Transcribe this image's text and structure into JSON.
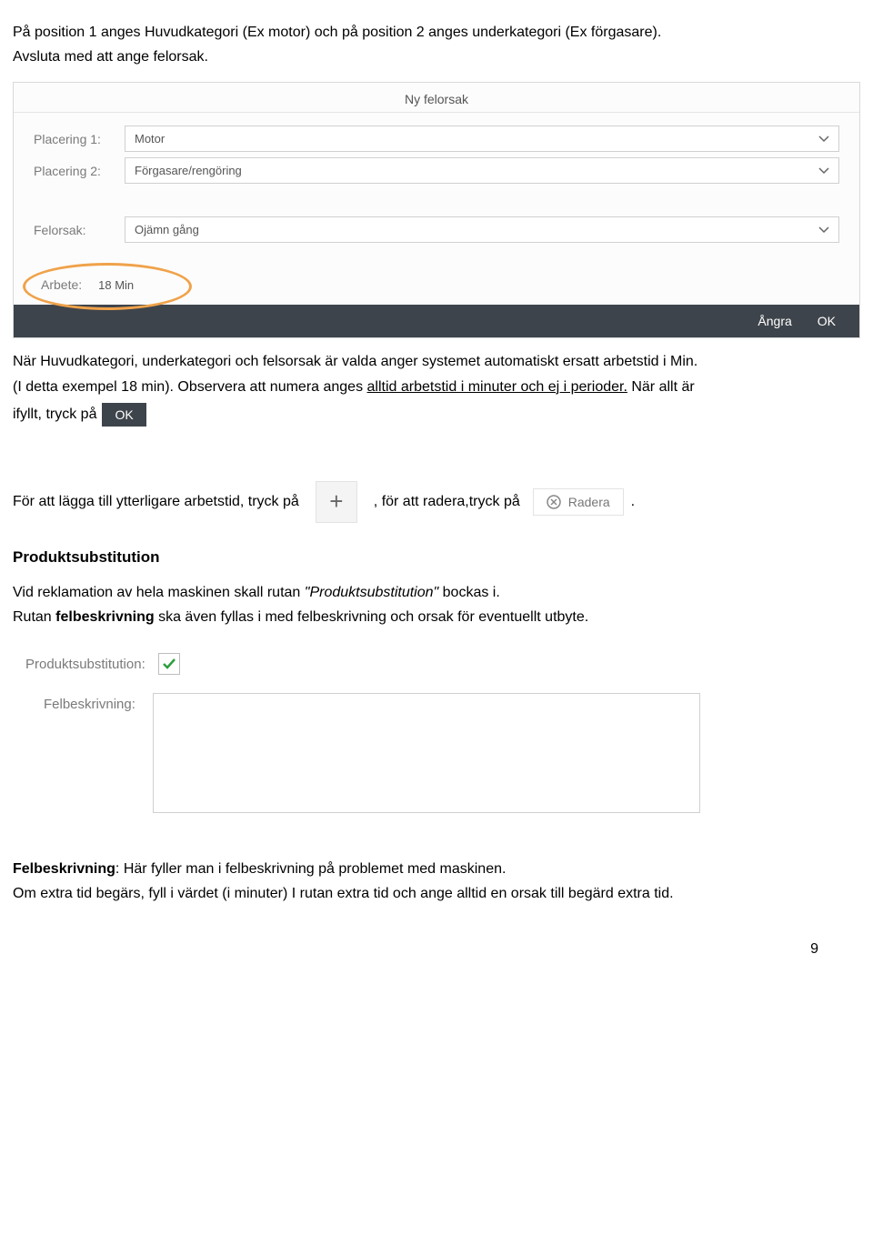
{
  "intro": {
    "line1": "På position 1 anges Huvudkategori (Ex motor) och på position 2 anges underkategori (Ex förgasare).",
    "line2": "Avsluta med att ange felorsak."
  },
  "dialog": {
    "title": "Ny felorsak",
    "labels": {
      "placering1": "Placering 1:",
      "placering2": "Placering 2:",
      "felorsak": "Felorsak:",
      "arbete": "Arbete:"
    },
    "values": {
      "placering1": "Motor",
      "placering2": "Förgasare/rengöring",
      "felorsak": "Ojämn gång",
      "arbete": "18 Min"
    },
    "footer": {
      "angra": "Ångra",
      "ok": "OK"
    }
  },
  "after_dialog": {
    "sentence_a": "När Huvudkategori, underkategori och felsorsak är valda anger systemet automatiskt ersatt arbetstid i Min.",
    "sentence_b_prefix": "(I detta exempel 18 min). Observera att numera anges ",
    "sentence_b_underline": "alltid arbetstid i minuter och ej i perioder.",
    "sentence_b_suffix": " När allt är",
    "ifyllt_prefix": "ifyllt, tryck på ",
    "ok_chip": "OK"
  },
  "add_line": {
    "part1": "För att lägga till ytterligare arbetstid, tryck på",
    "part2": ", för att radera,tryck på",
    "radera_label": "Radera",
    "period": "."
  },
  "produktsubstitution": {
    "heading": "Produktsubstitution",
    "p1_a": "Vid reklamation av hela maskinen skall rutan ",
    "p1_quote": "\"Produktsubstitution\"",
    "p1_b": " bockas i.",
    "p2_a": "Rutan ",
    "p2_bold": "felbeskrivning",
    "p2_b": " ska även fyllas i med felbeskrivning och orsak för eventuellt utbyte."
  },
  "ps_form": {
    "label": "Produktsubstitution:",
    "fb_label": "Felbeskrivning:"
  },
  "closing": {
    "fb_heading": "Felbeskrivning",
    "fb_text": ": Här fyller man i felbeskrivning på problemet med maskinen.",
    "extra_line": "Om extra tid begärs, fyll i värdet (i minuter) I rutan extra tid och ange alltid en orsak till begärd extra tid."
  },
  "page_number": "9"
}
